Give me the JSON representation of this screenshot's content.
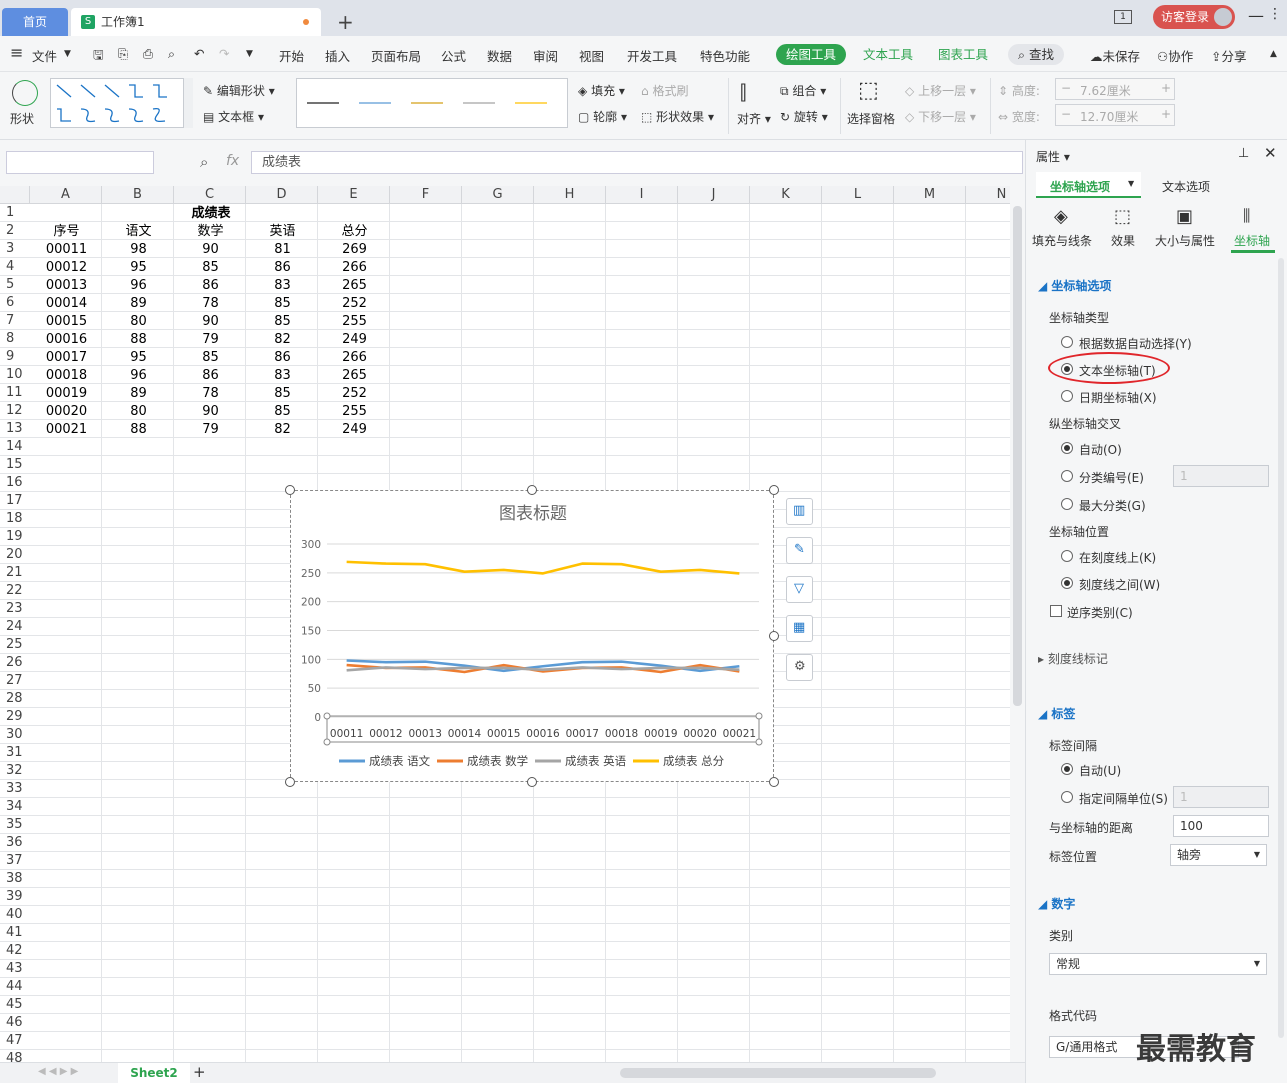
{
  "tabs": {
    "home": "首页",
    "book": "工作簿1",
    "new": "+"
  },
  "titlebar": {
    "visitor": "访客登录",
    "page_indicator": "1"
  },
  "menu": {
    "file": "文件",
    "items": [
      "开始",
      "插入",
      "页面布局",
      "公式",
      "数据",
      "审阅",
      "视图",
      "开发工具",
      "特色功能"
    ],
    "drawing_tools": "绘图工具",
    "text_tools": "文本工具",
    "chart_tools": "图表工具",
    "search": "查找",
    "unsaved": "未保存",
    "collab": "协作",
    "share": "分享"
  },
  "ribbon": {
    "shape": "形状",
    "edit_shape": "编辑形状",
    "textbox": "文本框",
    "fill": "填充",
    "format_brush": "格式刷",
    "outline": "轮廓",
    "shape_effect": "形状效果",
    "align": "对齐",
    "group": "组合",
    "rotate": "旋转",
    "select_pane": "选择窗格",
    "bring_forward": "上移一层",
    "send_backward": "下移一层",
    "height_label": "高度:",
    "height_value": "7.62厘米",
    "width_label": "宽度:",
    "width_value": "12.70厘米",
    "line_colors": [
      "#222222",
      "#5b9bd5",
      "#d4a017",
      "#a5a5a5",
      "#ffc000"
    ]
  },
  "formula": {
    "fx": "fx",
    "content": "成绩表",
    "namebox": ""
  },
  "sheet": {
    "columns": [
      "A",
      "B",
      "C",
      "D",
      "E",
      "F",
      "G",
      "H",
      "I",
      "J",
      "K",
      "L",
      "M",
      "N"
    ],
    "title": "成绩表",
    "headers": [
      "序号",
      "语文",
      "数学",
      "英语",
      "总分"
    ],
    "rows": [
      [
        "00011",
        "98",
        "90",
        "81",
        "269"
      ],
      [
        "00012",
        "95",
        "85",
        "86",
        "266"
      ],
      [
        "00013",
        "96",
        "86",
        "83",
        "265"
      ],
      [
        "00014",
        "89",
        "78",
        "85",
        "252"
      ],
      [
        "00015",
        "80",
        "90",
        "85",
        "255"
      ],
      [
        "00016",
        "88",
        "79",
        "82",
        "249"
      ],
      [
        "00017",
        "95",
        "85",
        "86",
        "266"
      ],
      [
        "00018",
        "96",
        "86",
        "83",
        "265"
      ],
      [
        "00019",
        "89",
        "78",
        "85",
        "252"
      ],
      [
        "00020",
        "80",
        "90",
        "85",
        "255"
      ],
      [
        "00021",
        "88",
        "79",
        "82",
        "249"
      ]
    ],
    "tab_name": "Sheet2"
  },
  "chart_data": {
    "type": "line",
    "title": "图表标题",
    "categories": [
      "00011",
      "00012",
      "00013",
      "00014",
      "00015",
      "00016",
      "00017",
      "00018",
      "00019",
      "00020",
      "00021"
    ],
    "ylim": [
      0,
      300
    ],
    "yticks": [
      0,
      50,
      100,
      150,
      200,
      250,
      300
    ],
    "grid": true,
    "legend": "bottom",
    "series": [
      {
        "name": "成绩表 语文",
        "color": "#5b9bd5",
        "values": [
          98,
          95,
          96,
          89,
          80,
          88,
          95,
          96,
          89,
          80,
          88
        ]
      },
      {
        "name": "成绩表 数学",
        "color": "#ed7d31",
        "values": [
          90,
          85,
          86,
          78,
          90,
          79,
          85,
          86,
          78,
          90,
          79
        ]
      },
      {
        "name": "成绩表 英语",
        "color": "#a5a5a5",
        "values": [
          81,
          86,
          83,
          85,
          85,
          82,
          86,
          83,
          85,
          85,
          82
        ]
      },
      {
        "name": "成绩表 总分",
        "color": "#ffc000",
        "values": [
          269,
          266,
          265,
          252,
          255,
          249,
          266,
          265,
          252,
          255,
          249
        ]
      }
    ]
  },
  "panel": {
    "title": "属性",
    "tab_axis": "坐标轴选项",
    "tab_text": "文本选项",
    "sub_fill": "填充与线条",
    "sub_effect": "效果",
    "sub_size": "大小与属性",
    "sub_axis": "坐标轴",
    "section_axis": "坐标轴选项",
    "axis_type": "坐标轴类型",
    "opt_auto": "根据数据自动选择(Y)",
    "opt_text": "文本坐标轴(T)",
    "opt_date": "日期坐标轴(X)",
    "cross": "纵坐标轴交叉",
    "cross_auto": "自动(O)",
    "cross_cat": "分类编号(E)",
    "cross_cat_val": "1",
    "cross_max": "最大分类(G)",
    "position": "坐标轴位置",
    "pos_on": "在刻度线上(K)",
    "pos_between": "刻度线之间(W)",
    "reverse": "逆序类别(C)",
    "tick_marks": "刻度线标记",
    "section_label": "标签",
    "label_interval": "标签间隔",
    "li_auto": "自动(U)",
    "li_unit": "指定间隔单位(S)",
    "li_unit_val": "1",
    "distance": "与坐标轴的距离",
    "distance_val": "100",
    "label_pos": "标签位置",
    "label_pos_val": "轴旁",
    "section_number": "数字",
    "category": "类别",
    "category_val": "常规",
    "format_code": "格式代码",
    "format_code_val": "G/通用格式"
  },
  "watermark": "最需教育"
}
